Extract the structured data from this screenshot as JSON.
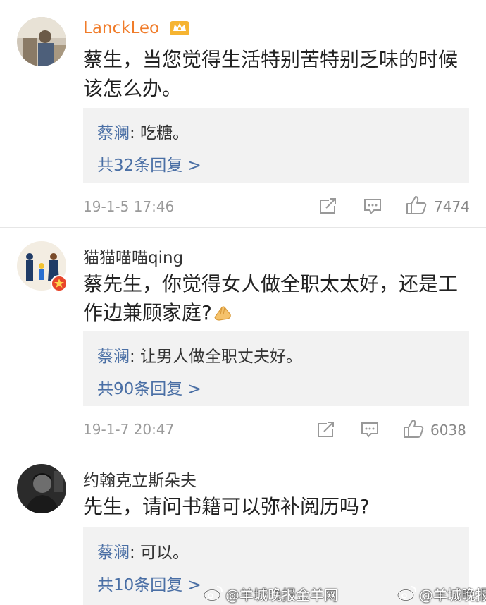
{
  "comments": [
    {
      "username": "LanckLeo",
      "text": "蔡生，当您觉得生活特别苦特别乏味的时候该怎么办。",
      "reply_author": "蔡澜",
      "reply_text": ": 吃糖。",
      "more_replies": "共32条回复 >",
      "timestamp": "19-1-5 17:46",
      "likes": "7474"
    },
    {
      "username": "猫猫喵喵qing",
      "text": "蔡先生，你觉得女人做全职太太好，还是工作边兼顾家庭?",
      "reply_author": "蔡澜",
      "reply_text": ": 让男人做全职丈夫好。",
      "more_replies": "共90条回复 >",
      "timestamp": "19-1-7 20:47",
      "likes": "6038"
    },
    {
      "username": "约翰克立斯朵夫",
      "text": "先生，请问书籍可以弥补阅历吗?",
      "reply_author": "蔡澜",
      "reply_text": ": 可以。",
      "more_replies": "共10条回复 >"
    }
  ],
  "watermarks": {
    "left": "@羊城晚报金羊网",
    "right": "@羊城晚报"
  },
  "icons": [
    "crown-icon",
    "share-icon",
    "comment-icon",
    "like-icon",
    "weibo-icon"
  ],
  "colors": {
    "username_vip": "#f07c2a",
    "link": "#4a6fa5",
    "reply_bg": "#f2f2f2",
    "meta": "#9a9a9a"
  }
}
